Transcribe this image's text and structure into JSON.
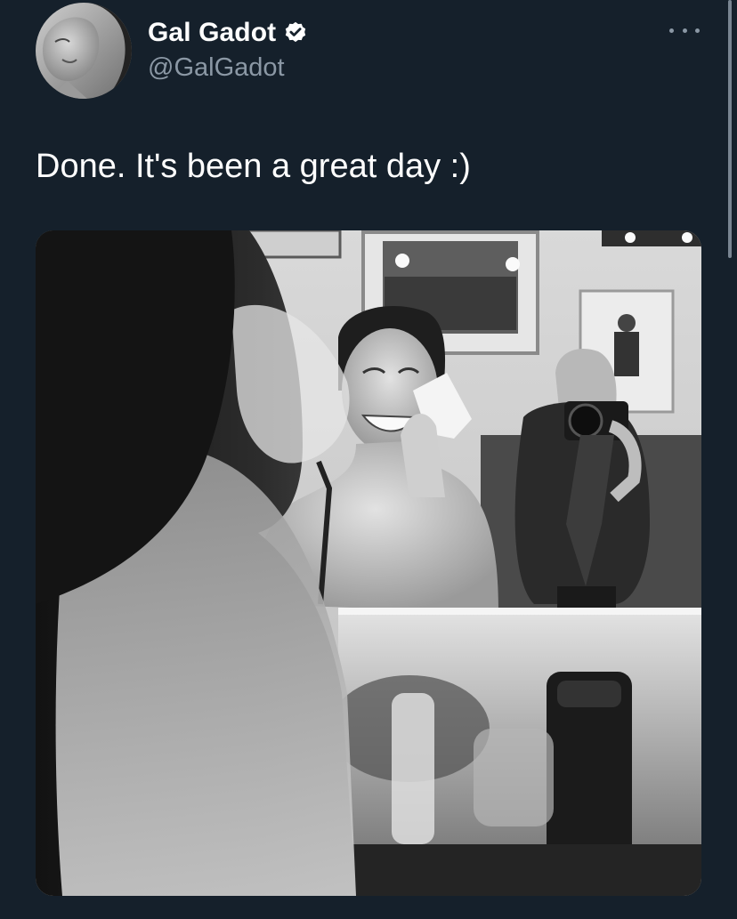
{
  "tweet": {
    "display_name": "Gal Gadot",
    "handle": "@GalGadot",
    "text": "Done. It's been a great day :)",
    "verified": true,
    "more_icon": "more-horizontal-icon"
  },
  "media": {
    "kind": "photo",
    "style": "black-and-white"
  },
  "colors": {
    "background": "#15202b",
    "text_primary": "#ffffff",
    "text_secondary": "#8b98a5",
    "verified_badge": "#ffffff"
  }
}
